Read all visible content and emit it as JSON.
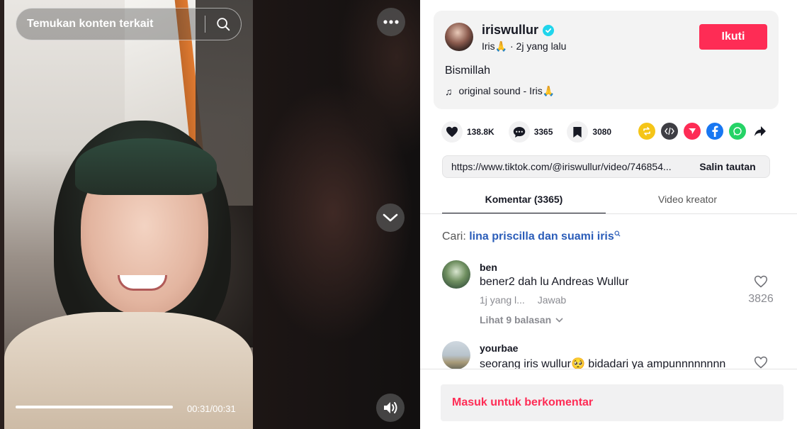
{
  "video": {
    "search_placeholder": "Temukan konten terkait",
    "time": "00:31/00:31",
    "progress": 1.0
  },
  "post": {
    "username": "iriswullur",
    "display_name": "Iris🙏",
    "posted": " · 2j yang lalu",
    "follow_label": "Ikuti",
    "caption": "Bismillah",
    "music_icon": "♫",
    "sound": "original sound - Iris🙏"
  },
  "stats": {
    "likes": "138.8K",
    "comments": "3365",
    "saves": "3080"
  },
  "share_icons": [
    "repost-icon",
    "embed-icon",
    "send-icon",
    "facebook-icon",
    "whatsapp-icon",
    "share-arrow-icon"
  ],
  "link": {
    "url": "https://www.tiktok.com/@iriswullur/video/746854...",
    "copy_label": "Salin tautan"
  },
  "tabs": [
    {
      "label": "Komentar (3365)",
      "active": true
    },
    {
      "label": "Video kreator",
      "active": false
    }
  ],
  "search_hint": {
    "prefix": "Cari:",
    "query": "lina priscilla dan suami iris"
  },
  "comments": [
    {
      "user": "ben",
      "text": "bener2 dah lu Andreas Wullur",
      "time": "1j yang l...",
      "reply_label": "Jawab",
      "likes": "3826",
      "view_replies": "Lihat 9 balasan"
    },
    {
      "user": "yourbae",
      "text": "seorang iris wullur🥺 bidadari ya ampunnnnnnnn"
    }
  ],
  "login_prompt": "Masuk untuk berkomentar",
  "colors": {
    "accent": "#fe2c55",
    "link": "#2b5db9",
    "verified": "#20d5ec"
  }
}
